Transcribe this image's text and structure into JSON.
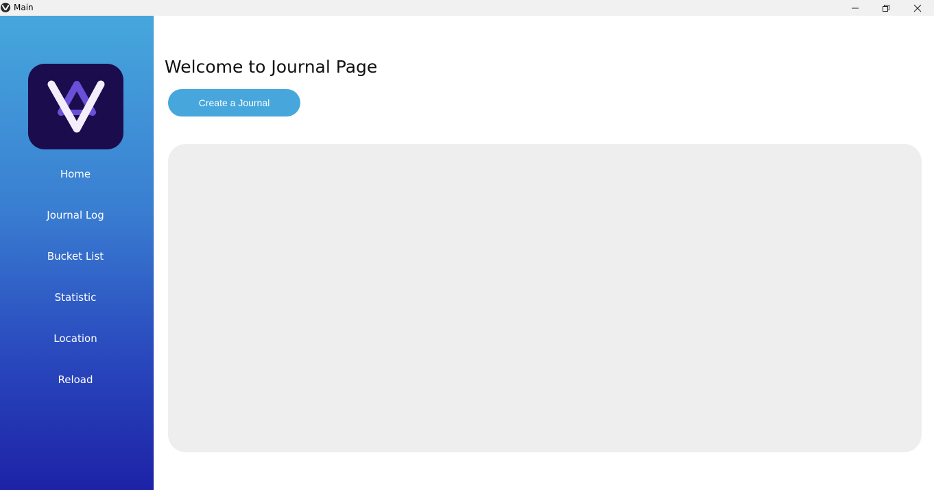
{
  "window": {
    "title": "Main",
    "controls": [
      "minimize-icon",
      "restore-icon",
      "close-icon"
    ]
  },
  "sidebar": {
    "logo": "app-logo",
    "items": [
      {
        "label": "Home"
      },
      {
        "label": "Journal Log"
      },
      {
        "label": "Bucket List"
      },
      {
        "label": "Statistic"
      },
      {
        "label": "Location"
      },
      {
        "label": "Reload"
      }
    ]
  },
  "main": {
    "title": "Welcome to Journal Page",
    "create_button": "Create a Journal"
  },
  "colors": {
    "accent": "#47a6dc",
    "sidebar_top": "#46a7dc",
    "sidebar_bottom": "#1d22a6",
    "logo_bg": "#1b0c4e",
    "logo_accent": "#6a4fd8",
    "panel_bg": "#eeeeee"
  }
}
